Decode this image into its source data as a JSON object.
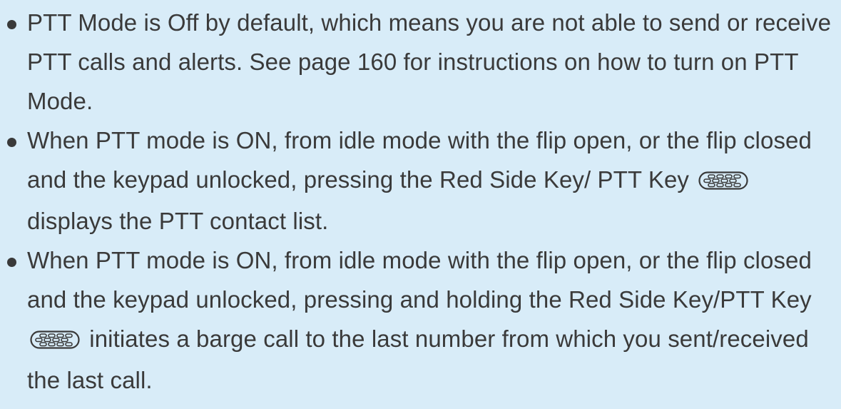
{
  "bullets": [
    {
      "text": "PTT Mode is Off by default, which means you are not able to send or receive PTT calls and alerts. See page 160 for instructions on how to turn on PTT Mode."
    },
    {
      "text_before": "When PTT mode is ON, from idle mode with the flip open, or the flip closed and the keypad unlocked, pressing the Red Side Key/ PTT Key",
      "icon": "ptt-key-icon",
      "text_after": "displays the PTT contact list."
    },
    {
      "text_before": "When PTT mode is ON, from idle mode with the flip open, or the flip closed and the keypad unlocked, pressing and holding the Red Side Key/PTT Key",
      "icon": "ptt-key-icon",
      "text_after": "initiates a barge call to the last number from which you sent/received the last call."
    }
  ],
  "colors": {
    "background": "#d8ecf8",
    "text": "#3a3a3a"
  }
}
